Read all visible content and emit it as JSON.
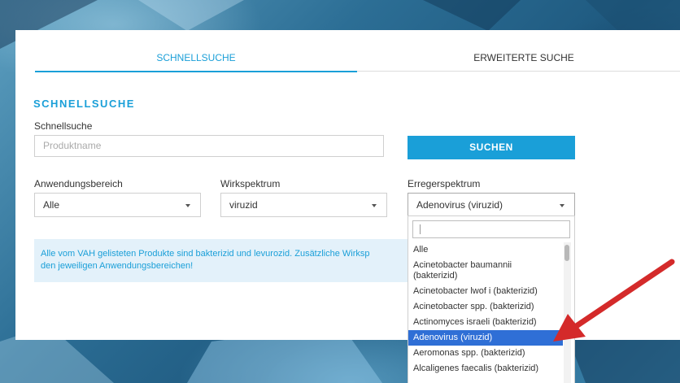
{
  "tabs": {
    "quick": "SCHNELLSUCHE",
    "advanced": "ERWEITERTE SUCHE"
  },
  "section_title": "SCHNELLSUCHE",
  "search": {
    "label": "Schnellsuche",
    "placeholder": "Produktname",
    "button": "SUCHEN"
  },
  "filters": [
    {
      "label": "Anwendungsbereich",
      "value": "Alle"
    },
    {
      "label": "Wirkspektrum",
      "value": "viruzid"
    },
    {
      "label": "Erregerspektrum",
      "value": "Adenovirus (viruzid)"
    }
  ],
  "info": {
    "line1": "Alle vom VAH gelisteten Produkte sind bakterizid und levurozid. Zusätzliche Wirksp",
    "line2": "den jeweiligen Anwendungsbereichen!"
  },
  "dropdown": {
    "items": [
      "Alle",
      "Acinetobacter baumannii (bakterizid)",
      "Acinetobacter lwof i (bakterizid)",
      "Acinetobacter spp. (bakterizid)",
      "Actinomyces israeli (bakterizid)",
      "Adenovirus (viruzid)",
      "Aeromonas spp. (bakterizid)",
      "Alcaligenes faecalis (bakterizid)"
    ],
    "selected_index": 5
  },
  "colors": {
    "accent": "#1a9fd8",
    "selected": "#2f6fd6",
    "arrow": "#d42a2a",
    "info_bg": "#e3f1fa"
  },
  "icons": [
    "chevron-down-icon",
    "red-arrow-icon"
  ]
}
